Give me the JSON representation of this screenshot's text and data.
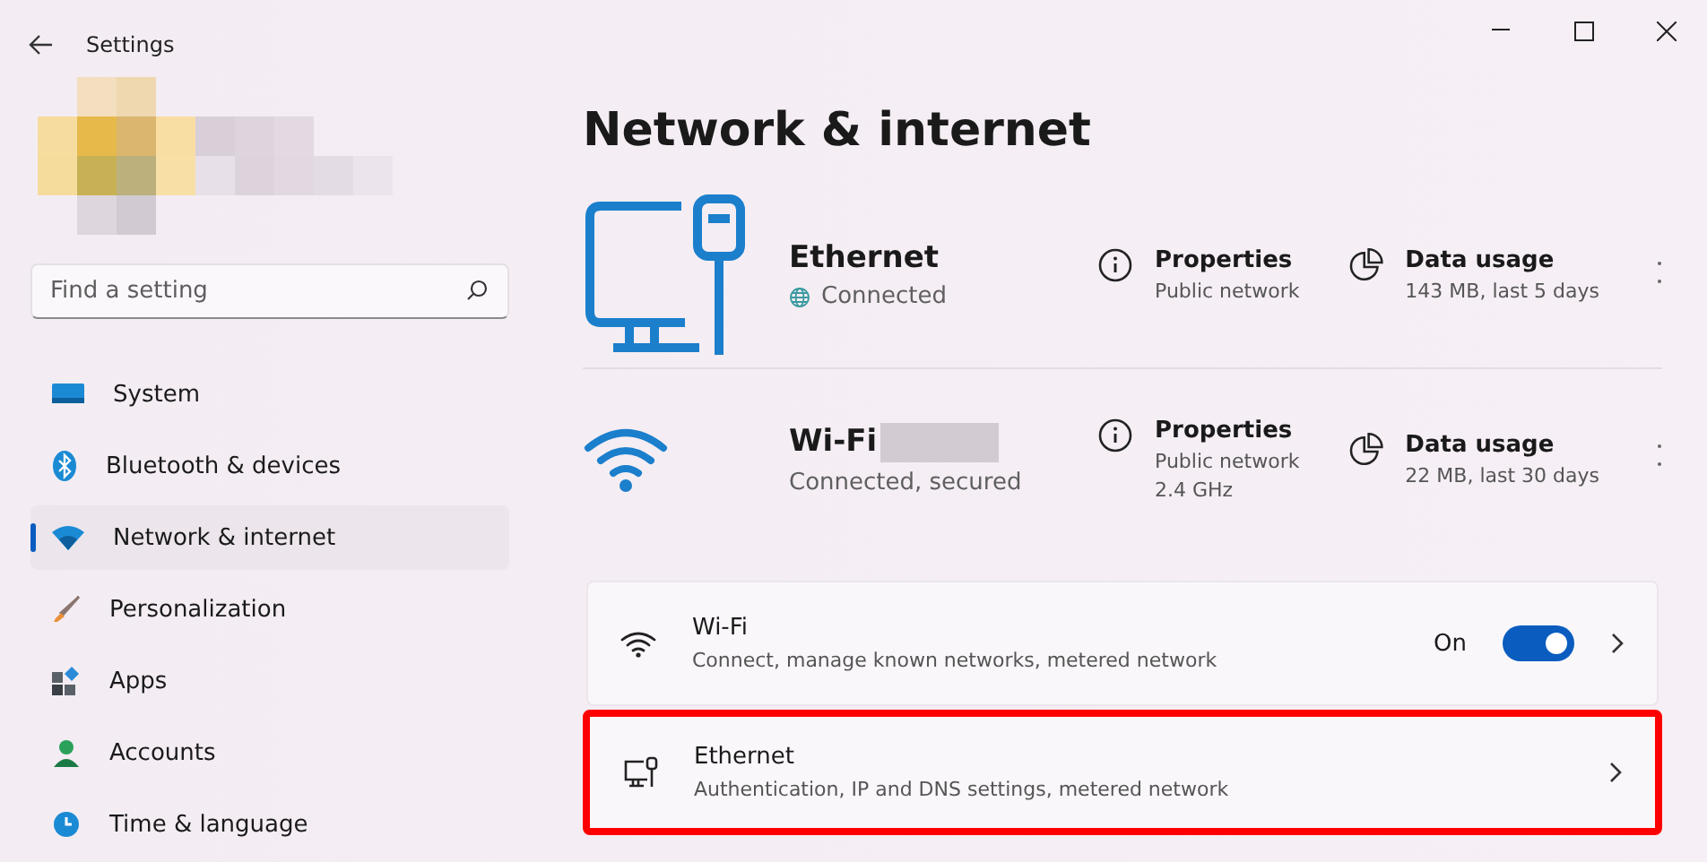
{
  "window": {
    "title": "Settings"
  },
  "search": {
    "placeholder": "Find a setting"
  },
  "sidebar": {
    "items": [
      {
        "label": "System",
        "kind": "system",
        "selected": false
      },
      {
        "label": "Bluetooth & devices",
        "kind": "bluetooth",
        "selected": false
      },
      {
        "label": "Network & internet",
        "kind": "network",
        "selected": true
      },
      {
        "label": "Personalization",
        "kind": "brush",
        "selected": false
      },
      {
        "label": "Apps",
        "kind": "apps",
        "selected": false
      },
      {
        "label": "Accounts",
        "kind": "accounts",
        "selected": false
      },
      {
        "label": "Time & language",
        "kind": "time",
        "selected": false
      }
    ]
  },
  "page_title": "Network & internet",
  "connections": [
    {
      "kind": "ethernet",
      "name": "Ethernet",
      "name_redacted": false,
      "status": "Connected",
      "status_globe": true,
      "properties": {
        "title": "Properties",
        "lines": [
          "Public network"
        ]
      },
      "usage": {
        "title": "Data usage",
        "text": "143 MB, last 5 days"
      }
    },
    {
      "kind": "wifi",
      "name": "Wi-Fi",
      "name_redacted": true,
      "status": "Connected, secured",
      "status_globe": false,
      "properties": {
        "title": "Properties",
        "lines": [
          "Public network",
          "2.4 GHz"
        ]
      },
      "usage": {
        "title": "Data usage",
        "text": "22 MB, last 30 days"
      }
    }
  ],
  "settings": [
    {
      "kind": "wifi",
      "title": "Wi-Fi",
      "subtitle": "Connect, manage known networks, metered network",
      "toggle_label": "On",
      "on": true,
      "highlighted": false
    },
    {
      "kind": "ethernet",
      "title": "Ethernet",
      "subtitle": "Authentication, IP and DNS settings, metered network",
      "highlighted": true
    }
  ]
}
